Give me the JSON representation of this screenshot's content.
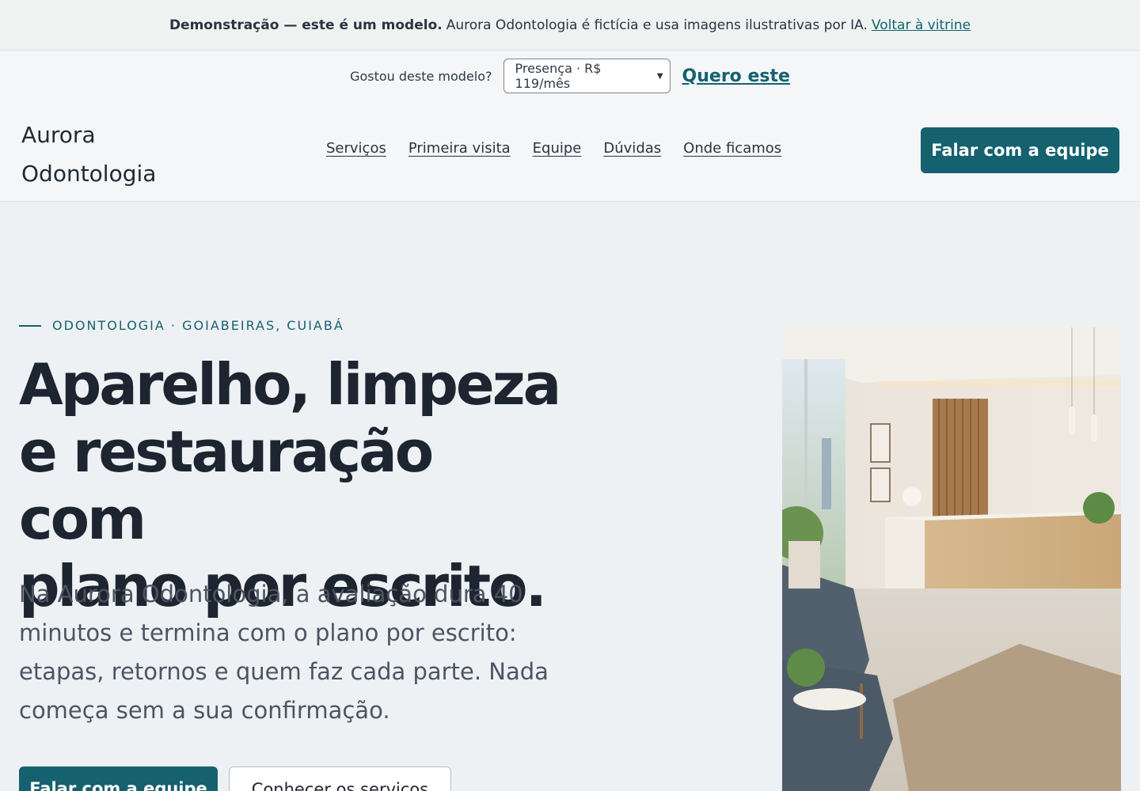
{
  "demo_banner": {
    "strong": "Demonstração — este é um modelo.",
    "text": "Aurora Odontologia é fictícia e usa imagens ilustrativas por IA.",
    "link": "Voltar à vitrine"
  },
  "model_picker": {
    "question": "Gostou deste modelo?",
    "selected": "Presença · R$ 119/mês",
    "cta": "Quero este"
  },
  "brand": {
    "line1": "Aurora",
    "line2": "Odontologia"
  },
  "nav": {
    "items": [
      "Serviços",
      "Primeira visita",
      "Equipe",
      "Dúvidas",
      "Onde ficamos"
    ],
    "cta": "Falar com a equipe"
  },
  "hero": {
    "eyebrow": "ODONTOLOGIA · GOIABEIRAS, CUIABÁ",
    "headline_lines": [
      "Aparelho, limpeza",
      "e restauração com",
      "plano por escrito."
    ],
    "lead": "Na Aurora Odontologia, a avaliação dura 40 minutos e termina com o plano por escrito: etapas, retornos e quem faz cada parte. Nada começa sem a sua confirmação.",
    "primary_cta": "Falar com a equipe",
    "secondary_cta": "Conhecer os serviços"
  },
  "colors": {
    "accent": "#15616f",
    "ink": "#1c2530",
    "muted": "#4a5561",
    "background": "#eef1f4"
  }
}
